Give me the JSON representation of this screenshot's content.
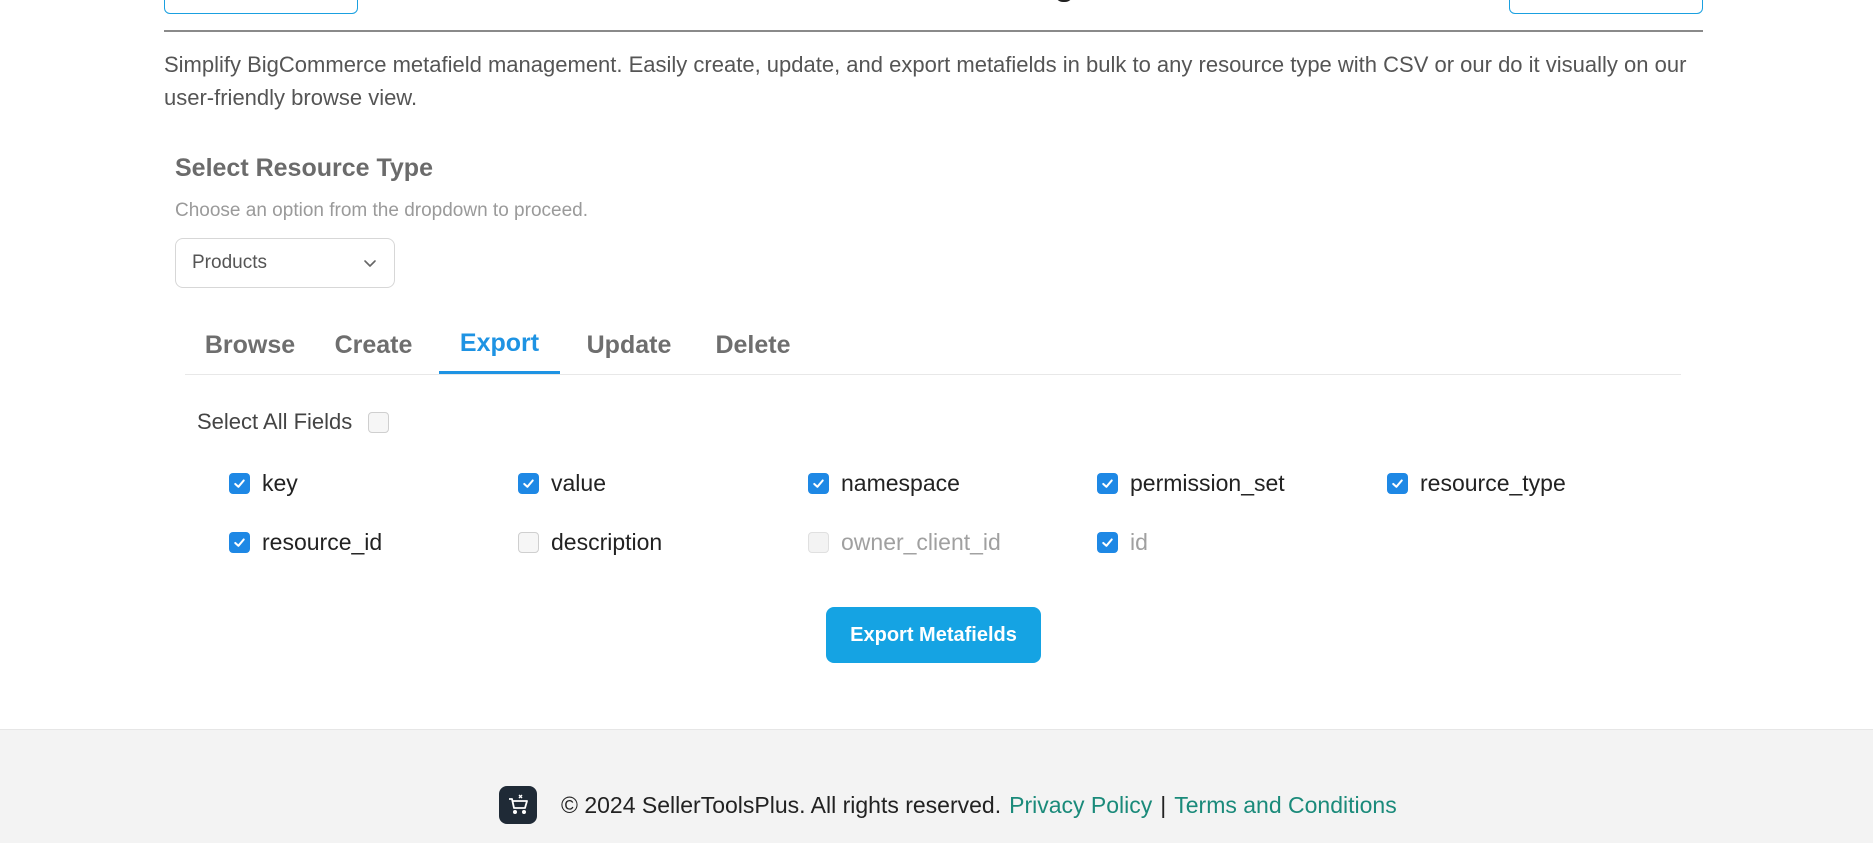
{
  "description": "Simplify BigCommerce metafield management. Easily create, update, and export metafields in bulk to any resource type with CSV or our do it visually on our user-friendly browse view.",
  "resource": {
    "title": "Select Resource Type",
    "hint": "Choose an option from the dropdown to proceed.",
    "selected": "Products"
  },
  "tabs": [
    {
      "label": "Browse"
    },
    {
      "label": "Create"
    },
    {
      "label": "Export",
      "active": true
    },
    {
      "label": "Update"
    },
    {
      "label": "Delete"
    }
  ],
  "export": {
    "select_all_label": "Select All Fields",
    "fields": [
      {
        "label": "key",
        "checked": true
      },
      {
        "label": "value",
        "checked": true
      },
      {
        "label": "namespace",
        "checked": true
      },
      {
        "label": "permission_set",
        "checked": true
      },
      {
        "label": "resource_type",
        "checked": true
      },
      {
        "label": "resource_id",
        "checked": true
      },
      {
        "label": "description",
        "checked": false
      },
      {
        "label": "owner_client_id",
        "checked": false,
        "disabled": true
      },
      {
        "label": "id",
        "checked": true,
        "disabled": true
      }
    ],
    "button_label": "Export Metafields"
  },
  "footer": {
    "copyright": "© 2024 SellerToolsPlus. All rights reserved.",
    "privacy_label": "Privacy Policy",
    "separator": "|",
    "terms_label": "Terms and Conditions"
  },
  "colors": {
    "accent": "#1e93e3",
    "button": "#15a3e3",
    "link": "#1a8a7a"
  }
}
